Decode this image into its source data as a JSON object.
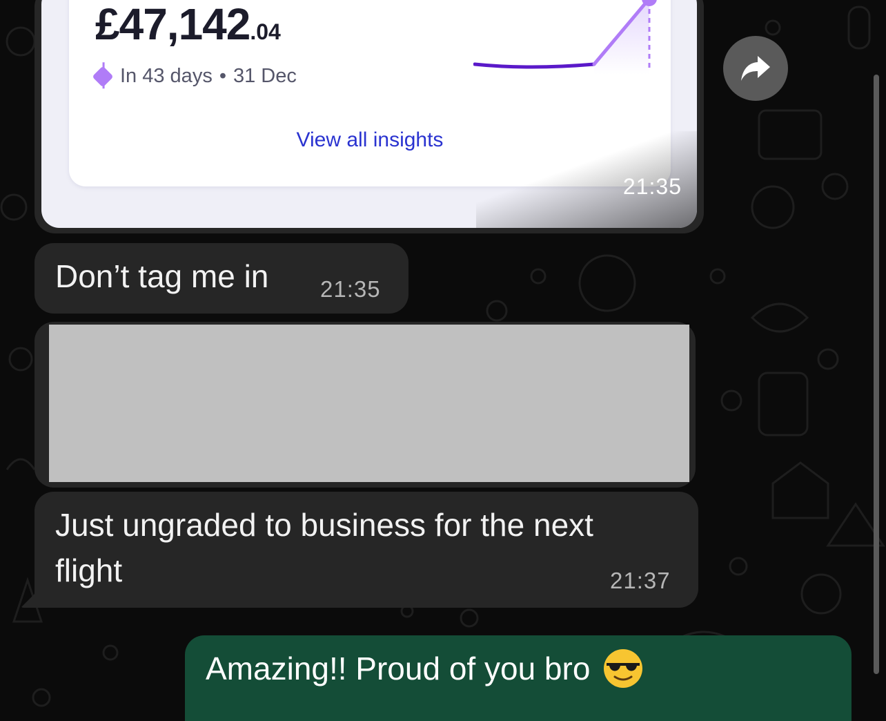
{
  "card": {
    "amount_main": "£47,142",
    "amount_decimal": ".04",
    "due_text": "In 43 days",
    "due_separator": "•",
    "due_date": "31 Dec",
    "link": "View all insights",
    "time": "21:35",
    "accent_color": "#b07cf7",
    "line_color": "#5a19c9"
  },
  "messages": [
    {
      "direction": "incoming",
      "text": "Don’t tag me in",
      "time": "21:35"
    },
    {
      "direction": "incoming",
      "type": "redacted-image"
    },
    {
      "direction": "incoming",
      "lines": [
        "Just ungraded to business for the  next",
        "flight"
      ],
      "time": "21:37"
    },
    {
      "direction": "outgoing",
      "text": "Amazing!! Proud of you bro",
      "emoji": "smiling-face-with-sunglasses"
    }
  ],
  "colors": {
    "background": "#0b0b0b",
    "incoming_bubble": "#262626",
    "outgoing_bubble": "#144d37",
    "link": "#2a33d0"
  },
  "icons": [
    "forward-icon",
    "diamond-icon"
  ]
}
